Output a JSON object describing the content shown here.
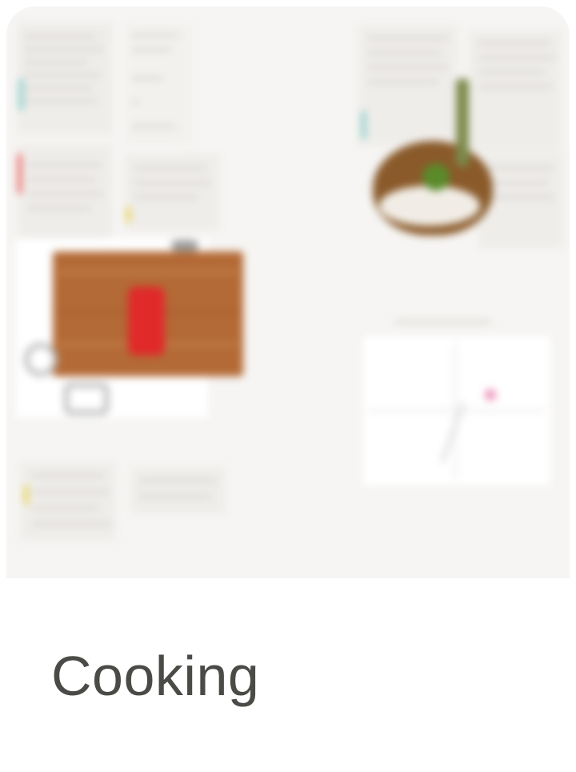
{
  "card": {
    "title": "Cooking"
  },
  "colors": {
    "card_bg": "#ffffff",
    "thumb_bg": "#f6f5f3",
    "title_text": "#4a4a46",
    "board_wood": "#b36a36",
    "knife_handle": "#e02a2a",
    "accent_red": "#e85a5a",
    "accent_teal": "#7ec8c4",
    "accent_yellow": "#e8d04a",
    "graph_point": "#e04a8a"
  },
  "icons": {
    "cutting_board": "cutting-board-illustration",
    "dish": "dish-photo"
  }
}
